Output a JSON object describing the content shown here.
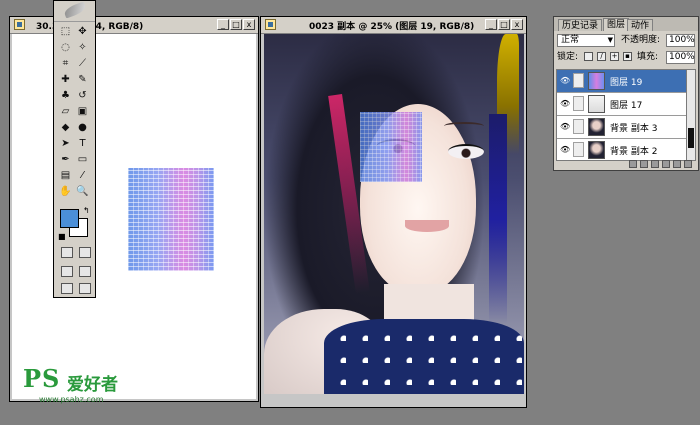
{
  "left_window": {
    "title": "30.3% (图层 4, RGB/8)"
  },
  "right_window": {
    "title": "0023 副本 @ 25% (图层 19, RGB/8)"
  },
  "window_buttons": {
    "minimize": "_",
    "maximize": "□",
    "close": "x"
  },
  "toolbox": {
    "tools": [
      {
        "name": "marquee-tool-icon",
        "glyph": "⬚"
      },
      {
        "name": "move-tool-icon",
        "glyph": "✥"
      },
      {
        "name": "lasso-tool-icon",
        "glyph": "◌"
      },
      {
        "name": "magic-wand-tool-icon",
        "glyph": "✧"
      },
      {
        "name": "crop-tool-icon",
        "glyph": "⌗"
      },
      {
        "name": "slice-tool-icon",
        "glyph": "⟋"
      },
      {
        "name": "healing-brush-tool-icon",
        "glyph": "✚"
      },
      {
        "name": "brush-tool-icon",
        "glyph": "✎"
      },
      {
        "name": "clone-stamp-tool-icon",
        "glyph": "♣"
      },
      {
        "name": "history-brush-tool-icon",
        "glyph": "↺"
      },
      {
        "name": "eraser-tool-icon",
        "glyph": "▱"
      },
      {
        "name": "gradient-tool-icon",
        "glyph": "▣"
      },
      {
        "name": "blur-tool-icon",
        "glyph": "◆"
      },
      {
        "name": "dodge-tool-icon",
        "glyph": "●"
      },
      {
        "name": "path-selection-tool-icon",
        "glyph": "➤"
      },
      {
        "name": "type-tool-icon",
        "glyph": "T"
      },
      {
        "name": "pen-tool-icon",
        "glyph": "✒"
      },
      {
        "name": "shape-tool-icon",
        "glyph": "▭"
      },
      {
        "name": "notes-tool-icon",
        "glyph": "▤"
      },
      {
        "name": "eyedropper-tool-icon",
        "glyph": "⁄"
      },
      {
        "name": "hand-tool-icon",
        "glyph": "✋"
      },
      {
        "name": "zoom-tool-icon",
        "glyph": "🔍"
      }
    ],
    "foreground_color": "#4b8fd8",
    "background_color": "#ffffff"
  },
  "layers_panel": {
    "tabs": [
      "历史记录",
      "图层",
      "动作"
    ],
    "active_tab": "图层",
    "blend_mode": "正常",
    "opacity_label": "不透明度:",
    "opacity_value": "100%",
    "lock_label": "锁定:",
    "fill_label": "填充:",
    "fill_value": "100%",
    "layers": [
      {
        "name": "图层 19",
        "selected": true
      },
      {
        "name": "图层 17",
        "selected": false
      },
      {
        "name": "背景 副本 3",
        "selected": false
      },
      {
        "name": "背景 副本 2",
        "selected": false
      }
    ]
  },
  "watermark": {
    "logo": "PS",
    "text": "爱好者",
    "url": "www.psahz.com"
  }
}
